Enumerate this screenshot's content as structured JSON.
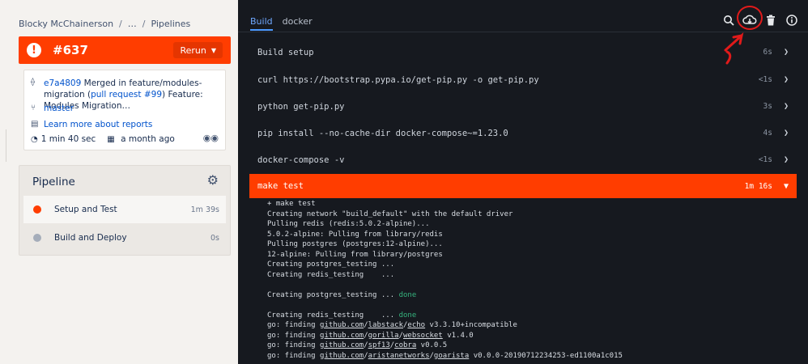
{
  "breadcrumb": {
    "owner": "Blocky McChainerson",
    "ellipsis": "…",
    "current": "Pipelines"
  },
  "status": {
    "build_number": "#637",
    "rerun_label": "Rerun",
    "failed_icon": "!"
  },
  "commit": {
    "hash": "e7a4809",
    "message_before": "Merged in feature/modules-migration (",
    "pull_request": "pull request #99",
    "message_after": ") Feature: Modules Migration…",
    "branch": "master",
    "reports_link": "Learn more about reports",
    "duration": "1 min 40 sec",
    "date": "a month ago"
  },
  "pipeline": {
    "title": "Pipeline",
    "steps": [
      {
        "name": "Setup and Test",
        "duration": "1m 39s",
        "status": "failed"
      },
      {
        "name": "Build and Deploy",
        "duration": "0s",
        "status": "pending"
      }
    ]
  },
  "log_viewer": {
    "tabs": [
      "Build",
      "docker"
    ],
    "commands": [
      {
        "text": "Build setup",
        "duration": "6s"
      },
      {
        "text": "curl https://bootstrap.pypa.io/get-pip.py -o get-pip.py",
        "duration": "<1s"
      },
      {
        "text": "python get-pip.py",
        "duration": "3s"
      },
      {
        "text": "pip install --no-cache-dir docker-compose~=1.23.0",
        "duration": "4s"
      },
      {
        "text": "docker-compose -v",
        "duration": "<1s"
      },
      {
        "text": "make test",
        "duration": "1m 16s"
      }
    ],
    "output": {
      "l1": "+ make test",
      "l2": "Creating network \"build_default\" with the default driver",
      "l3": "Pulling redis (redis:5.0.2-alpine)...",
      "l4": "5.0.2-alpine: Pulling from library/redis",
      "l5": "Pulling postgres (postgres:12-alpine)...",
      "l6": "12-alpine: Pulling from library/postgres",
      "l7": "Creating postgres_testing ...",
      "l8": "Creating redis_testing    ...",
      "l9a": "Creating postgres_testing ... ",
      "l10a": "Creating redis_testing    ... ",
      "done": "done",
      "l11a": "go: finding ",
      "l11b": "github.com",
      "l11c": "/",
      "l11d": "labstack",
      "l11e": "/",
      "l11f": "echo",
      "l11g": " v3.3.10+incompatible",
      "l12a": "go: finding ",
      "l12b": "github.com",
      "l12c": "/",
      "l12d": "gorilla",
      "l12e": "/",
      "l12f": "websocket",
      "l12g": " v1.4.0",
      "l13a": "go: finding ",
      "l13b": "github.com",
      "l13c": "/",
      "l13d": "spf13",
      "l13e": "/",
      "l13f": "cobra",
      "l13g": " v0.0.5",
      "l14a": "go: finding ",
      "l14b": "github.com",
      "l14c": "/",
      "l14d": "aristanetworks",
      "l14e": "/",
      "l14f": "goarista",
      "l14g": " v0.0.0-20190712234253-ed1100a1c015"
    }
  },
  "colors": {
    "failed": "#ff3d00",
    "link": "#0052cc",
    "done": "#36b37e",
    "log_bg": "#16191f",
    "annotation": "#e11a1a"
  },
  "icons": [
    "alert-icon",
    "commit-icon",
    "branch-icon",
    "reports-icon",
    "clock-icon",
    "calendar-icon",
    "eyes-icon",
    "gear-icon",
    "search-icon",
    "download-cloud-icon",
    "trash-icon",
    "info-icon",
    "chevron-right-icon",
    "chevron-down-icon"
  ]
}
